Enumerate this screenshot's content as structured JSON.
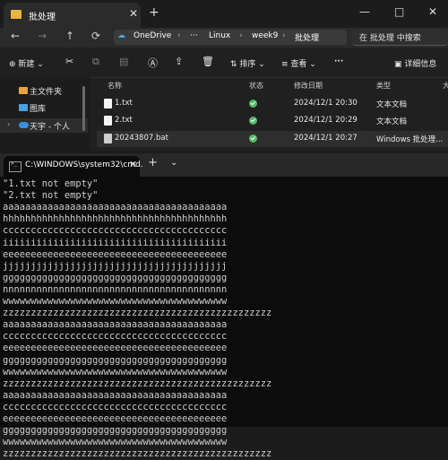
{
  "explorer": {
    "tab_title": "批处理",
    "tab_close": "✕",
    "new_tab": "+",
    "window_controls": {
      "minimize": "—",
      "maximize": "□",
      "close": "✕"
    },
    "address_segments": [
      "OneDrive",
      "›",
      "···",
      "Linux",
      "›",
      "week9",
      "›",
      "批处理"
    ],
    "search_placeholder": "在 批处理 中搜索",
    "toolbar": {
      "new_label": "新建",
      "sort_label": "排序",
      "view_label": "查看",
      "more_label": "···",
      "details_label": "详细信息"
    },
    "sidebar": [
      {
        "label": "主文件夹",
        "color": "#e8a33a"
      },
      {
        "label": "图库",
        "color": "#4aa3df"
      },
      {
        "label": "天宇 - 个人",
        "color": "#3b8ee0"
      }
    ],
    "columns": [
      "名称",
      "状态",
      "修改日期",
      "类型",
      "大"
    ],
    "files": [
      {
        "name": "1.txt",
        "date": "2024/12/1 20:30",
        "type": "文本文档"
      },
      {
        "name": "2.txt",
        "date": "2024/12/1 20:29",
        "type": "文本文档"
      },
      {
        "name": "20243807.bat",
        "date": "2024/12/1 20:27",
        "type": "Windows 批处理..."
      }
    ]
  },
  "cmd": {
    "tab_title": "C:\\WINDOWS\\system32\\cmd.",
    "tab_close": "✕",
    "plus": "+",
    "dropdown": "⌄",
    "lines": [
      "\"1.txt not empty\"",
      "\"2.txt not empty\"",
      "aaaaaaaaaaaaaaaaaaaaaaaaaaaaaaaaaaaaaaaa",
      "hhhhhhhhhhhhhhhhhhhhhhhhhhhhhhhhhhhhhhhh",
      "cccccccccccccccccccccccccccccccccccccccc",
      "iiiiiiiiiiiiiiiiiiiiiiiiiiiiiiiiiiiiiiii",
      "eeeeeeeeeeeeeeeeeeeeeeeeeeeeeeeeeeeeeeee",
      "jjjjjjjjjjjjjjjjjjjjjjjjjjjjjjjjjjjjjjjj",
      "gggggggggggggggggggggggggggggggggggggggg",
      "nnnnnnnnnnnnnnnnnnnnnnnnnnnnnnnnnnnnnnnn",
      "wwwwwwwwwwwwwwwwwwwwwwwwwwwwwwwwwwwwwwww",
      "zzzzzzzzzzzzzzzzzzzzzzzzzzzzzzzzzzzzzzzzzzzzzzzz",
      "aaaaaaaaaaaaaaaaaaaaaaaaaaaaaaaaaaaaaaaa",
      "cccccccccccccccccccccccccccccccccccccccc",
      "eeeeeeeeeeeeeeeeeeeeeeeeeeeeeeeeeeeeeeee",
      "gggggggggggggggggggggggggggggggggggggggg",
      "wwwwwwwwwwwwwwwwwwwwwwwwwwwwwwwwwwwwwwww",
      "zzzzzzzzzzzzzzzzzzzzzzzzzzzzzzzzzzzzzzzzzzzzzzzz",
      "aaaaaaaaaaaaaaaaaaaaaaaaaaaaaaaaaaaaaaaa",
      "cccccccccccccccccccccccccccccccccccccccc",
      "eeeeeeeeeeeeeeeeeeeeeeeeeeeeeeeeeeeeeeee",
      "gggggggggggggggggggggggggggggggggggggggg",
      "wwwwwwwwwwwwwwwwwwwwwwwwwwwwwwwwwwwwwwww",
      "zzzzzzzzzzzzzzzzzzzzzzzzzzzzzzzzzzzzzzzzzzzzzzzz"
    ]
  }
}
